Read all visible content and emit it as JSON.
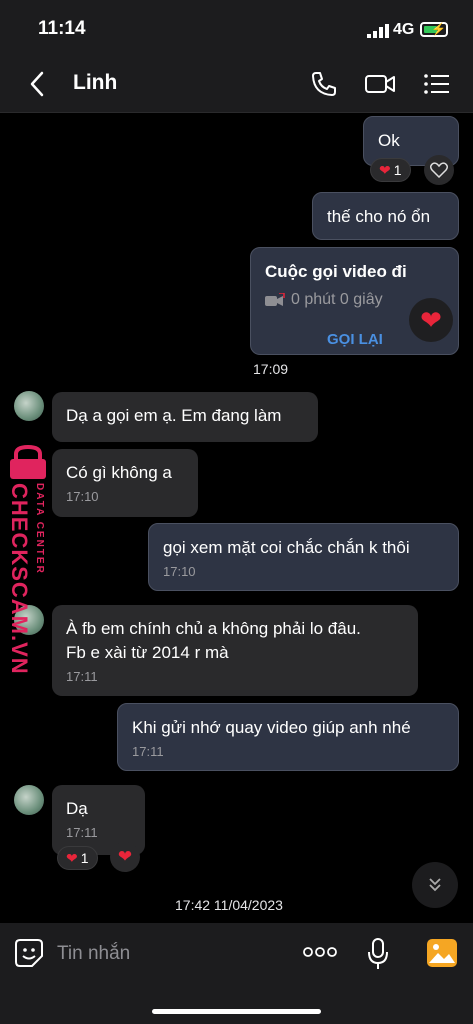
{
  "status": {
    "time": "11:14",
    "network": "4G"
  },
  "header": {
    "title": "Linh"
  },
  "messages": {
    "m1": {
      "text": "Ok",
      "reaction_count": "1"
    },
    "m2": {
      "text": "thế cho nó ổn"
    },
    "call": {
      "title": "Cuộc gọi video đi",
      "duration": "0 phút 0 giây",
      "callback": "GỌI LẠI"
    },
    "stamp1": "17:09",
    "m3": {
      "text": "Dạ a gọi em ạ. Em đang làm"
    },
    "m4": {
      "text": "Có gì không a",
      "time": "17:10"
    },
    "m5": {
      "text": "gọi xem mặt coi chắc chắn k thôi",
      "time": "17:10"
    },
    "m6": {
      "line1": "À fb em chính chủ a không phải lo đâu.",
      "line2": "Fb e xài từ 2014 r mà",
      "time": "17:11"
    },
    "m7": {
      "text": "Khi gửi nhớ quay video giúp anh nhé",
      "time": "17:11"
    },
    "m8": {
      "text": "Dạ",
      "time": "17:11",
      "reaction_count": "1"
    },
    "stamp2": "17:42 11/04/2023"
  },
  "watermark": {
    "line1": "DATA CENTER",
    "line2": "CHECKSCAM.VN"
  },
  "input": {
    "placeholder": "Tin nhắn"
  },
  "colors": {
    "accent": "#4a90e2",
    "heart": "#e8253a",
    "watermark": "#e0245e"
  }
}
